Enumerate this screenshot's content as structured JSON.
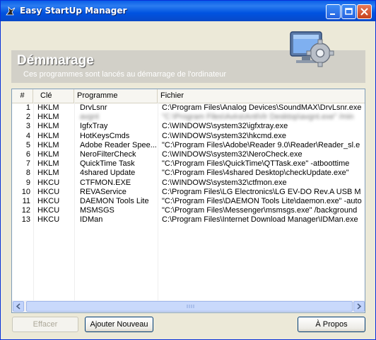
{
  "window": {
    "title": "Easy StartUp Manager"
  },
  "header": {
    "title": "Démmarage",
    "subtitle": "Ces programmes sont lancés au démarrage de l'ordinateur"
  },
  "columns": [
    "#",
    "Clé",
    "Programme",
    "Fichier"
  ],
  "rows": [
    {
      "num": "1",
      "key": "HKLM",
      "program": "DrvLsnr",
      "file": "C:\\Program Files\\Analog Devices\\SoundMAX\\DrvLsnr.exe",
      "blurred": false
    },
    {
      "num": "2",
      "key": "HKLM",
      "program": "avgnt",
      "file": "\"C:\\Program Files\\Avira\\AntiVir Desktop\\avgnt.exe\" /min",
      "blurred": true
    },
    {
      "num": "3",
      "key": "HKLM",
      "program": "IgfxTray",
      "file": "C:\\WINDOWS\\system32\\igfxtray.exe",
      "blurred": false
    },
    {
      "num": "4",
      "key": "HKLM",
      "program": "HotKeysCmds",
      "file": "C:\\WINDOWS\\system32\\hkcmd.exe",
      "blurred": false
    },
    {
      "num": "5",
      "key": "HKLM",
      "program": "Adobe Reader Spee...",
      "file": "\"C:\\Program Files\\Adobe\\Reader 9.0\\Reader\\Reader_sl.e",
      "blurred": false
    },
    {
      "num": "6",
      "key": "HKLM",
      "program": "NeroFilterCheck",
      "file": "C:\\WINDOWS\\system32\\NeroCheck.exe",
      "blurred": false
    },
    {
      "num": "7",
      "key": "HKLM",
      "program": "QuickTime Task",
      "file": "\"C:\\Program Files\\QuickTime\\QTTask.exe\" -atboottime",
      "blurred": false
    },
    {
      "num": "8",
      "key": "HKLM",
      "program": "4shared Update",
      "file": "\"C:\\Program Files\\4shared Desktop\\checkUpdate.exe\"",
      "blurred": false
    },
    {
      "num": "9",
      "key": "HKCU",
      "program": "CTFMON.EXE",
      "file": "C:\\WINDOWS\\system32\\ctfmon.exe",
      "blurred": false
    },
    {
      "num": "10",
      "key": "HKCU",
      "program": "REVAService",
      "file": "C:\\Program Files\\LG Electronics\\LG EV-DO Rev.A USB M",
      "blurred": false
    },
    {
      "num": "11",
      "key": "HKCU",
      "program": "DAEMON Tools Lite",
      "file": "\"C:\\Program Files\\DAEMON Tools Lite\\daemon.exe\" -auto",
      "blurred": false
    },
    {
      "num": "12",
      "key": "HKCU",
      "program": "MSMSGS",
      "file": "\"C:\\Program Files\\Messenger\\msmsgs.exe\" /background",
      "blurred": false
    },
    {
      "num": "13",
      "key": "HKCU",
      "program": "IDMan",
      "file": "C:\\Program Files\\Internet Download Manager\\IDMan.exe",
      "blurred": false
    }
  ],
  "buttons": {
    "delete": "Effacer",
    "add": "Ajouter Nouveau",
    "about": "À Propos"
  },
  "colors": {
    "title_bar": "#0a5fe8",
    "header_bg": "#d2d0c8",
    "selection": "#316ac5"
  }
}
